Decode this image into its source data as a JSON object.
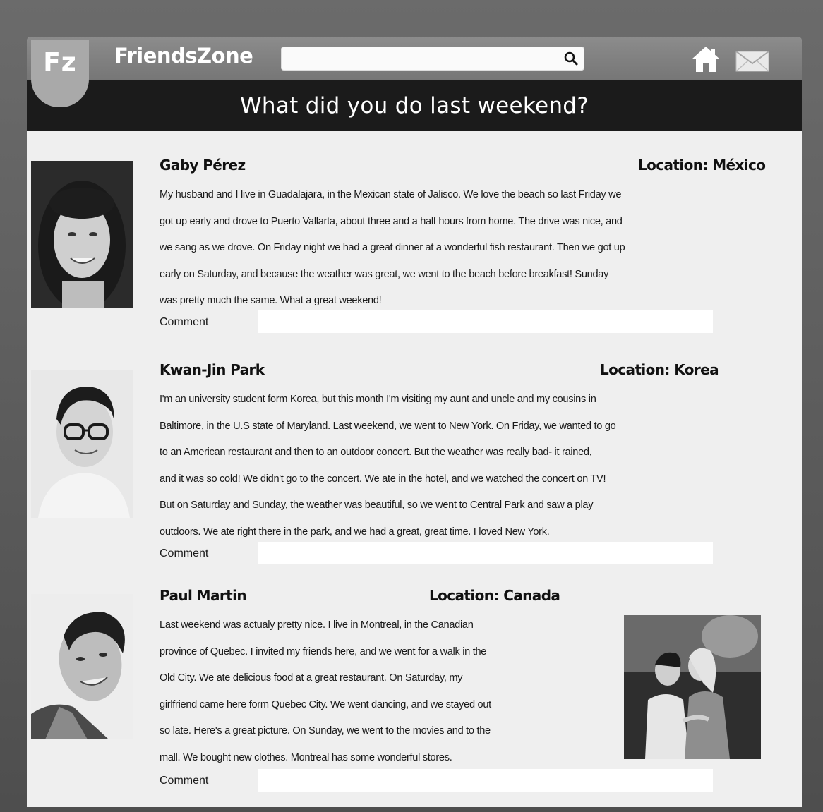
{
  "app": {
    "logo": "Fz",
    "name": "FriendsZone"
  },
  "search": {
    "value": "",
    "placeholder": ""
  },
  "icons": {
    "search": "search-icon",
    "home": "home-icon",
    "mail": "mail-icon"
  },
  "page": {
    "title": "What did you do last weekend?"
  },
  "posts": [
    {
      "name": "Gaby Pérez",
      "location": "Location: México",
      "lines": [
        "My husband and I live in Guadalajara, in the Mexican state of Jalisco. We love the beach so last Friday we",
        "got up early and drove to Puerto Vallarta, about three and a half hours from home. The drive was nice, and",
        "we sang as we drove. On Friday night we had a great dinner at a wonderful fish restaurant. Then we got up",
        "early on Saturday, and because the weather was great, we went to the beach before breakfast! Sunday",
        "was pretty much the same. What a great weekend!"
      ],
      "comment_label": "Comment",
      "comment_value": ""
    },
    {
      "name": "Kwan-Jin Park",
      "location": "Location: Korea",
      "lines": [
        "I'm an university student form Korea, but this month I'm visiting my aunt and uncle and my cousins in",
        "Baltimore, in the U.S state of Maryland. Last weekend, we went to New York. On Friday, we wanted to go",
        "to an American restaurant and then to an outdoor concert. But the weather was really bad- it rained,",
        "and it was so cold! We didn't go to the concert. We ate in the hotel, and we watched the concert on TV!",
        "But on Saturday and Sunday, the weather was beautiful, so we went to Central Park and saw a play",
        "outdoors. We ate right there in the park, and we had a great, great time. I loved New York."
      ],
      "comment_label": "Comment",
      "comment_value": ""
    },
    {
      "name": "Paul Martin",
      "location": "Location: Canada",
      "lines": [
        "Last weekend was actualy pretty nice. I live in Montreal, in the Canadian",
        "province of Quebec. I invited my friends here, and we went for a walk in the",
        "Old City. We ate delicious food at a great restaurant. On Saturday, my",
        "girlfriend came here form Quebec City. We went dancing, and we stayed out",
        "so late. Here's a great picture. On Sunday, we went to the movies and to the",
        "mall. We bought new clothes. Montreal has some wonderful stores."
      ],
      "comment_label": "Comment",
      "comment_value": ""
    }
  ]
}
